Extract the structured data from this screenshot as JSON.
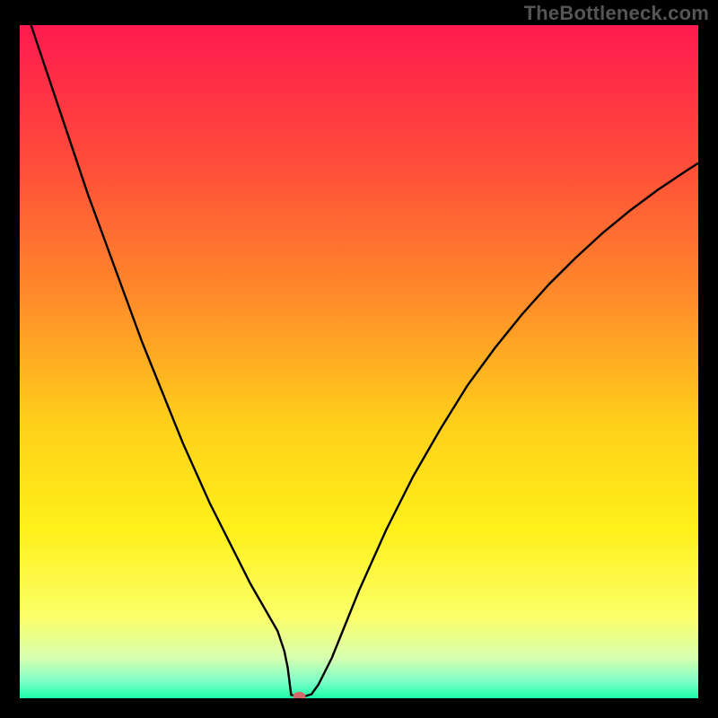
{
  "watermark": "TheBottleneck.com",
  "chart_data": {
    "type": "line",
    "title": "",
    "xlabel": "",
    "ylabel": "",
    "xlim": [
      0,
      100
    ],
    "ylim": [
      0,
      100
    ],
    "background_gradient": {
      "stops": [
        {
          "pos": 0.0,
          "color": "#ff1a4f"
        },
        {
          "pos": 0.2,
          "color": "#ff4b3a"
        },
        {
          "pos": 0.4,
          "color": "#ff8a2a"
        },
        {
          "pos": 0.6,
          "color": "#ffd21a"
        },
        {
          "pos": 0.75,
          "color": "#fff01a"
        },
        {
          "pos": 0.88,
          "color": "#fbff6a"
        },
        {
          "pos": 0.94,
          "color": "#d7ffb0"
        },
        {
          "pos": 0.975,
          "color": "#7dffc8"
        },
        {
          "pos": 1.0,
          "color": "#1affa8"
        }
      ]
    },
    "series": [
      {
        "name": "bottleneck-curve",
        "color": "#000000",
        "x": [
          0,
          2,
          4,
          6,
          8,
          10,
          12,
          14,
          16,
          18,
          20,
          22,
          24,
          26,
          28,
          30,
          32,
          34,
          36,
          38,
          39,
          39.5,
          40,
          41,
          42,
          43,
          44,
          46,
          48,
          50,
          54,
          58,
          62,
          66,
          70,
          74,
          78,
          82,
          86,
          90,
          94,
          98,
          100
        ],
        "y": [
          105,
          99,
          93,
          87,
          81,
          75,
          69.5,
          64,
          58.5,
          53,
          48,
          43,
          38,
          33.5,
          29,
          25,
          21,
          17,
          13.5,
          10,
          7,
          4.5,
          0.5,
          0.3,
          0.3,
          0.6,
          2,
          6,
          11,
          16,
          25,
          33,
          40,
          46.5,
          52,
          57,
          61.5,
          65.5,
          69.2,
          72.5,
          75.5,
          78.2,
          79.5
        ]
      }
    ],
    "marker": {
      "name": "optimal-point",
      "x": 41.2,
      "y": 0.3,
      "color": "#d46a6a",
      "rx": 7,
      "ry": 5
    }
  }
}
